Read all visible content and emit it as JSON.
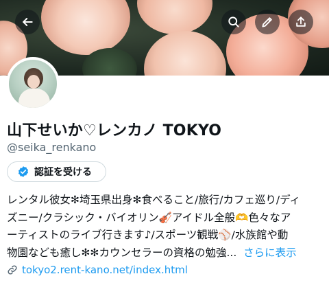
{
  "header": {
    "back_icon": "arrow-left-icon",
    "search_icon": "search-icon",
    "edit_icon": "pencil-icon",
    "share_icon": "share-upload-icon"
  },
  "profile": {
    "display_name": "山下せいか♡レンカノ TOKYO",
    "handle": "@seika_renkano",
    "verify_button_label": "認証を受ける",
    "verify_icon": "verified-badge-icon",
    "bio_lines": [
      "レンタル彼女✻埼玉県出身✻食べること/旅行/カフェ巡り/ディ",
      "ズニー/クラシック・バイオリン🎻アイドル全般🫶色々なア",
      "ーティストのライブ行きます♪/スポーツ観戦⚾/水族館や動",
      "物園なども癒し✻✻カウンセラーの資格の勉強..."
    ],
    "bio_more": "さらに表示",
    "website": "tokyo2.rent-kano.net/index.html",
    "website_icon": "link-icon"
  },
  "colors": {
    "accent": "#1d9bf0",
    "text_primary": "#0f1419",
    "text_secondary": "#536471",
    "border": "#cfd9de"
  }
}
